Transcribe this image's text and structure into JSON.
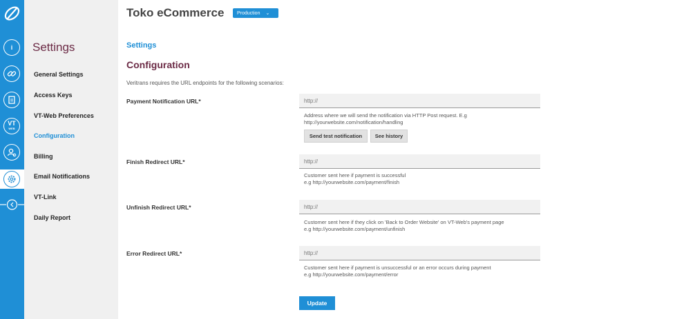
{
  "rail": {
    "icons": [
      "logo-icon",
      "info-icon",
      "link-icon",
      "document-icon",
      "vt-web-icon",
      "user-icon",
      "settings-icon",
      "collapse-icon"
    ],
    "vt_label": "VT",
    "vt_sub": "WEB",
    "accent": "#1f8fd6"
  },
  "sidebar": {
    "title": "Settings",
    "items": [
      {
        "label": "General Settings"
      },
      {
        "label": "Access Keys"
      },
      {
        "label": "VT-Web Preferences"
      },
      {
        "label": "Configuration"
      },
      {
        "label": "Billing"
      },
      {
        "label": "Email Notifications"
      },
      {
        "label": "VT-Link"
      },
      {
        "label": "Daily Report"
      }
    ],
    "active": "Configuration"
  },
  "header": {
    "title": "Toko eCommerce",
    "environment": "Production"
  },
  "main": {
    "breadcrumb": "Settings",
    "heading": "Configuration",
    "intro": "Veritrans requires the URL endpoints for the following scenarios:",
    "fields": [
      {
        "label": "Payment Notification URL*",
        "placeholder": "http://",
        "help_1": "Address where we will send the notification via HTTP Post request. E.g",
        "help_2": "http://yourwebsite.com/notification/handling"
      },
      {
        "label": "Finish Redirect URL*",
        "placeholder": "http://",
        "help_1": "Customer sent here if payment is successful",
        "help_2": "e.g http://yourwebsite.com/payment/finish"
      },
      {
        "label": "Unfinish Redirect URL*",
        "placeholder": "http://",
        "help_1": "Customer sent here if they click on 'Back to Order Website' on VT-Web's payment page",
        "help_2": "e.g http://yourwebsite.com/payment/unfinish"
      },
      {
        "label": "Error Redirect URL*",
        "placeholder": "http://",
        "help_1": "Customer sent here if payment is unsuccessful or an error occurs during payment",
        "help_2": "e.g http://yourwebsite.com/payment/error"
      }
    ],
    "send_test_label": "Send test notification",
    "history_label": "See history",
    "update_label": "Update"
  }
}
